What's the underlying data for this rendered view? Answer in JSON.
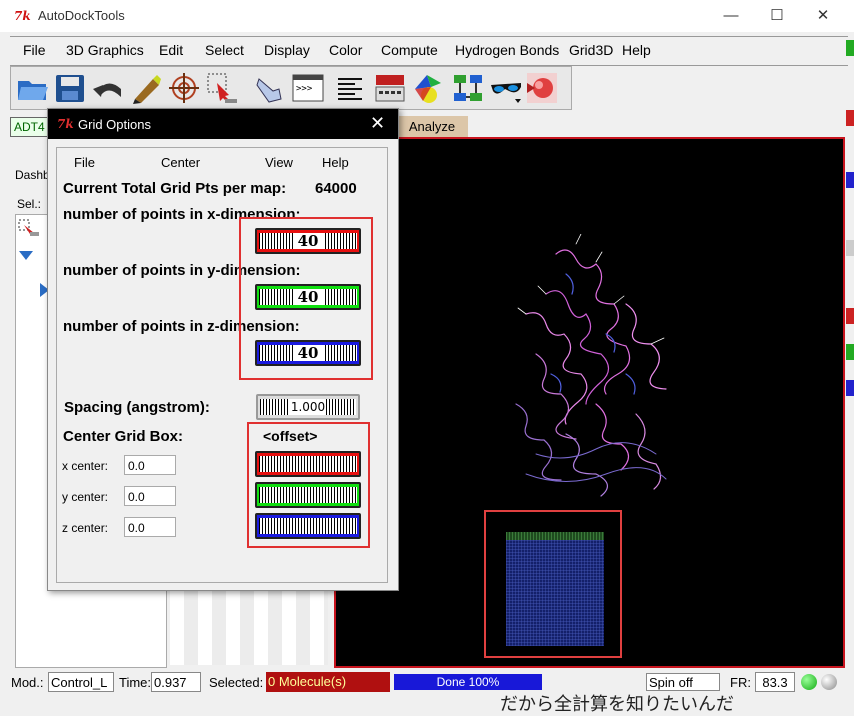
{
  "window": {
    "title": "AutoDockTools",
    "minimize": "—",
    "maximize": "☐",
    "close": "✕"
  },
  "menu": [
    "File",
    "3D Graphics",
    "Edit",
    "Select",
    "Display",
    "Color",
    "Compute",
    "Hydrogen Bonds",
    "Grid3D",
    "Help"
  ],
  "tabs": {
    "adt4": "ADT4",
    "analyze": "Analyze"
  },
  "left_panel": {
    "dashboard": "Dashb",
    "sel": "Sel.:"
  },
  "dialog": {
    "title": "Grid Options",
    "menu": [
      "File",
      "Center",
      "View",
      "Help"
    ],
    "total_pts_label": "Current Total Grid Pts per map:",
    "total_pts_value": "64000",
    "x_label": "number of points in x-dimension:",
    "y_label": "number of points in y-dimension:",
    "z_label": "number of points in z-dimension:",
    "x_value": "40",
    "y_value": "40",
    "z_value": "40",
    "spacing_label": "Spacing (angstrom):",
    "spacing_value": "1.000",
    "center_label": "Center Grid Box:",
    "offset_label": "<offset>",
    "x_center_label": "x center:",
    "y_center_label": "y center:",
    "z_center_label": "z center:",
    "x_center": "0.0",
    "y_center": "0.0",
    "z_center": "0.0"
  },
  "status": {
    "mod_label": "Mod.:",
    "mod_value": "Control_L",
    "time_label": "Time:",
    "time_value": "0.937",
    "selected_label": "Selected:",
    "selected_value": "0 Molecule(s)",
    "progress": "Done 100%",
    "spin": "Spin off",
    "fr_label": "FR:",
    "fr_value": "83.3"
  },
  "overlay_text": "だから全計算を知りたいんだ",
  "colors": {
    "x_axis": "#e81010",
    "y_axis": "#10e010",
    "z_axis": "#1a1ae0",
    "highlight": "#e03030",
    "molecule": "#e070e0"
  }
}
